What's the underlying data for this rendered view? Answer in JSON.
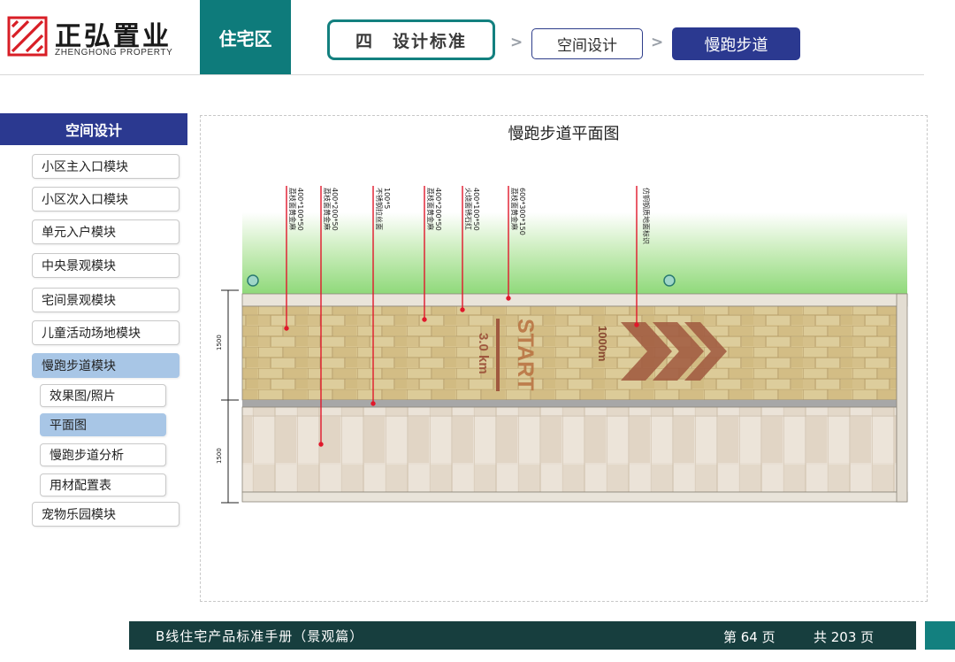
{
  "brand": {
    "name_cn": "正弘置业",
    "name_en": "ZHENGHONG PROPERTY",
    "accent_color": "#0e7b7b",
    "navy_color": "#2b3990"
  },
  "header": {
    "zone": "住宅区",
    "breadcrumb": {
      "section": "四　设计标准",
      "category": "空间设计",
      "current": "慢跑步道",
      "separator": ">"
    }
  },
  "sidebar": {
    "title": "空间设计",
    "items": [
      {
        "label": "小区主入口模块",
        "active": false
      },
      {
        "label": "小区次入口模块",
        "active": false
      },
      {
        "label": "单元入户模块",
        "active": false
      },
      {
        "label": "中央景观模块",
        "active": false
      },
      {
        "label": "宅间景观模块",
        "active": false
      },
      {
        "label": "儿童活动场地模块",
        "active": false
      },
      {
        "label": "慢跑步道模块",
        "active": true
      },
      {
        "label": "宠物乐园模块",
        "active": false
      }
    ],
    "subitems": [
      {
        "label": "效果图/照片",
        "active": false
      },
      {
        "label": "平面图",
        "active": true
      },
      {
        "label": "慢跑步道分析",
        "active": false
      },
      {
        "label": "用材配置表",
        "active": false
      }
    ]
  },
  "plan": {
    "title": "慢跑步道平面图",
    "annotations": [
      {
        "line1": "400*100*50",
        "line2": "荔枝面黄金麻"
      },
      {
        "line1": "400*200*50",
        "line2": "荔枝面黄金麻"
      },
      {
        "line1": "100*5",
        "line2": "不锈钢拉丝面"
      },
      {
        "line1": "400*200*50",
        "line2": "荔枝面黄金麻"
      },
      {
        "line1": "400*100*50",
        "line2": "火烧面锈石红"
      },
      {
        "line1": "600*300*150",
        "line2": "荔枝面黄金麻"
      },
      {
        "line1": "仿铜钢质地面标识",
        "line2": ""
      }
    ],
    "dimensions": [
      "1500",
      "1500"
    ],
    "track_text": {
      "start": "START",
      "distance": "3.0 km",
      "marker": "1000m"
    },
    "colors": {
      "grass": "#8fd97a",
      "jogging_lane": "#d8c48e",
      "brick_joint": "#b09866",
      "walkway": "#e6dccf",
      "steel_strip": "#9c9c9c",
      "red_marking": "#a0593f",
      "leader_line": "#e0182b"
    }
  },
  "footer": {
    "title": "B线住宅产品标准手册（景观篇）",
    "page": "第 64 页",
    "total": "共 203 页"
  }
}
